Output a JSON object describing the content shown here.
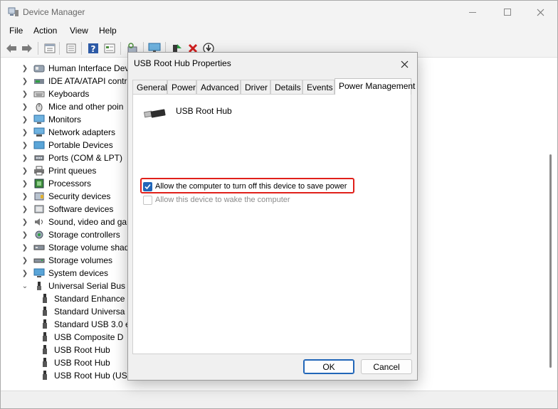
{
  "window": {
    "title": "Device Manager"
  },
  "menu": [
    "File",
    "Action",
    "View",
    "Help"
  ],
  "toolbar": {
    "icons": [
      "back-icon",
      "forward-icon",
      "properties-list-icon",
      "show-hidden-icon",
      "help-icon",
      "view-icon",
      "scan-hardware-icon",
      "monitor-icon",
      "update-driver-icon",
      "uninstall-icon",
      "download-icon"
    ]
  },
  "tree": {
    "items": [
      {
        "label": "Human Interface Devi",
        "icon": "hid-icon",
        "expanded": false
      },
      {
        "label": "IDE ATA/ATAPI contro",
        "icon": "ide-icon",
        "expanded": false
      },
      {
        "label": "Keyboards",
        "icon": "keyboard-icon",
        "expanded": false
      },
      {
        "label": "Mice and other poin",
        "icon": "mouse-icon",
        "expanded": false
      },
      {
        "label": "Monitors",
        "icon": "monitor-icon",
        "expanded": false
      },
      {
        "label": "Network adapters",
        "icon": "network-icon",
        "expanded": false
      },
      {
        "label": "Portable Devices",
        "icon": "portable-icon",
        "expanded": false
      },
      {
        "label": "Ports (COM & LPT)",
        "icon": "port-icon",
        "expanded": false
      },
      {
        "label": "Print queues",
        "icon": "printer-icon",
        "expanded": false
      },
      {
        "label": "Processors",
        "icon": "processor-icon",
        "expanded": false
      },
      {
        "label": "Security devices",
        "icon": "security-icon",
        "expanded": false
      },
      {
        "label": "Software devices",
        "icon": "software-icon",
        "expanded": false
      },
      {
        "label": "Sound, video and gar",
        "icon": "sound-icon",
        "expanded": false
      },
      {
        "label": "Storage controllers",
        "icon": "storage-controller-icon",
        "expanded": false
      },
      {
        "label": "Storage volume shado",
        "icon": "storage-shadow-icon",
        "expanded": false
      },
      {
        "label": "Storage volumes",
        "icon": "storage-volume-icon",
        "expanded": false
      },
      {
        "label": "System devices",
        "icon": "system-icon",
        "expanded": false
      },
      {
        "label": "Universal Serial Bus co",
        "icon": "usb-controller-icon",
        "expanded": true
      }
    ],
    "usb_children": [
      "Standard Enhance",
      "Standard Universa",
      "Standard USB 3.0 e",
      "USB Composite D",
      "USB Root Hub",
      "USB Root Hub",
      "USB Root Hub (US"
    ]
  },
  "dialog": {
    "title": "USB Root Hub Properties",
    "tabs": [
      "General",
      "Power",
      "Advanced",
      "Driver",
      "Details",
      "Events",
      "Power Management"
    ],
    "active_tab": "Power Management",
    "device_name": "USB Root Hub",
    "options": [
      {
        "label": "Allow the computer to turn off this device to save power",
        "checked": true,
        "enabled": true
      },
      {
        "label": "Allow this device to wake the computer",
        "checked": false,
        "enabled": false
      }
    ],
    "ok_label": "OK",
    "cancel_label": "Cancel"
  },
  "colors": {
    "accent": "#2166b8",
    "highlight": "#e0201a"
  }
}
